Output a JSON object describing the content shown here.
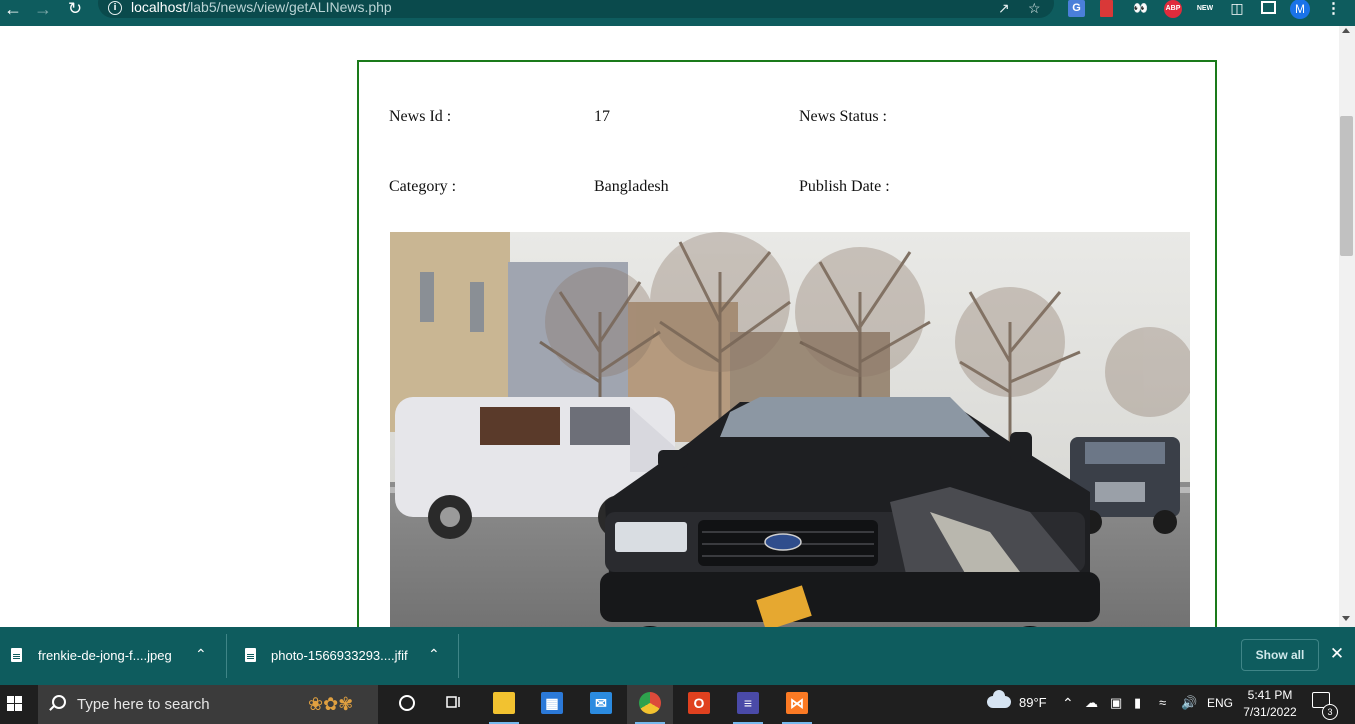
{
  "browser": {
    "url_host": "localhost",
    "url_path": "/lab5/news/view/getALINews.php",
    "extensions": [
      {
        "name": "google-translate-icon",
        "label": "G"
      },
      {
        "name": "bookmark-extension-icon",
        "label": ""
      },
      {
        "name": "eyes-extension-icon",
        "label": "👀"
      },
      {
        "name": "adblock-plus-icon",
        "label": "ABP"
      },
      {
        "name": "new-badge-extension-icon",
        "label": "NEW"
      }
    ],
    "profile_initial": "M"
  },
  "news": {
    "id_label": "News Id :",
    "id_value": "17",
    "status_label": "News Status :",
    "status_value": "",
    "category_label": "Category :",
    "category_value": "Bangladesh",
    "publish_label": "Publish Date :",
    "publish_value": ""
  },
  "downloads": {
    "items": [
      {
        "name": "frenkie-de-jong-f....jpeg"
      },
      {
        "name": "photo-1566933293....jfif"
      }
    ],
    "show_all_label": "Show all"
  },
  "taskbar": {
    "search_placeholder": "Type here to search",
    "apps": [
      {
        "name": "file-explorer-icon",
        "color": "#f2c230"
      },
      {
        "name": "microsoft-store-icon",
        "color": "#2b79d8"
      },
      {
        "name": "mail-icon",
        "color": "#2b8be0"
      },
      {
        "name": "chrome-icon",
        "color": "#dd4a3a"
      },
      {
        "name": "office-icon",
        "color": "#e0411f"
      },
      {
        "name": "calculator-app-icon",
        "color": "#4a4aa8"
      },
      {
        "name": "xampp-icon",
        "color": "#fb7a24"
      }
    ],
    "temperature": "89°F",
    "language": "ENG",
    "time": "5:41 PM",
    "date": "7/31/2022",
    "notification_count": "3"
  },
  "colors": {
    "browser_chrome": "#0e5c5e",
    "card_border": "#1a7a1a",
    "taskbar": "#1f1f1f"
  }
}
